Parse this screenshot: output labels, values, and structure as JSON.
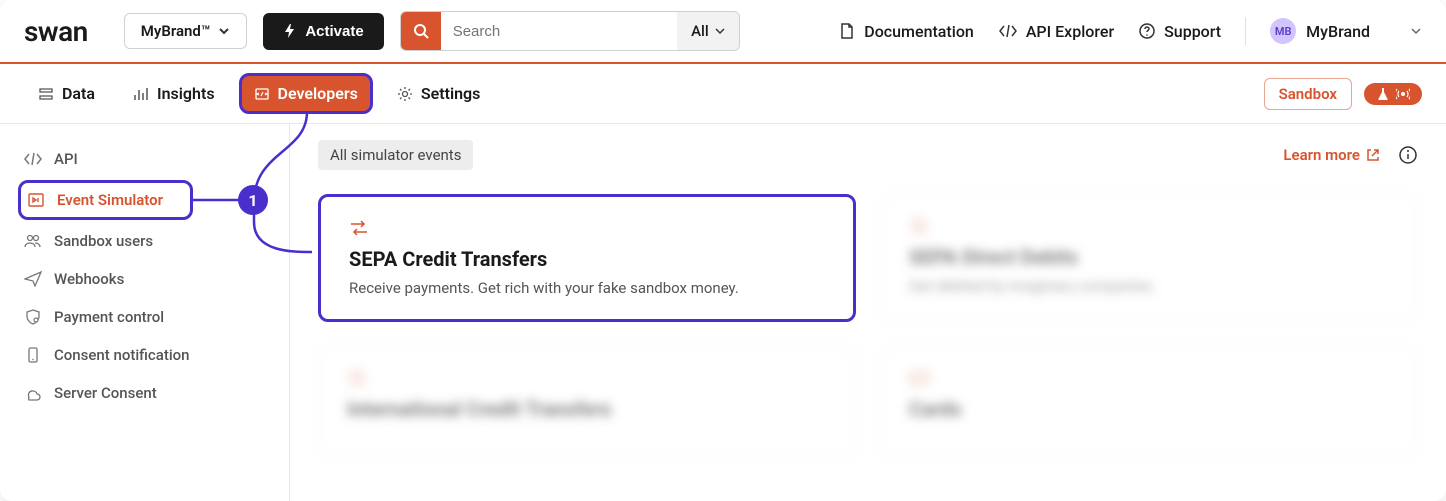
{
  "header": {
    "logo": "swan",
    "brand": "MyBrand™",
    "activate": "Activate",
    "search_placeholder": "Search",
    "search_filter": "All",
    "links": {
      "docs": "Documentation",
      "api": "API Explorer",
      "support": "Support"
    },
    "user": {
      "initials": "MB",
      "name": "MyBrand"
    }
  },
  "nav": {
    "tabs": [
      "Data",
      "Insights",
      "Developers",
      "Settings"
    ],
    "active": 2,
    "sandbox": "Sandbox"
  },
  "sidebar": {
    "items": [
      "API",
      "Event Simulator",
      "Sandbox users",
      "Webhooks",
      "Payment control",
      "Consent notification",
      "Server Consent"
    ],
    "active": 1
  },
  "content": {
    "chip": "All simulator events",
    "learn": "Learn more",
    "cards": [
      {
        "title": "SEPA Credit Transfers",
        "desc": "Receive payments. Get rich with your fake sandbox money."
      },
      {
        "title": "SEPA Direct Debits",
        "desc": "Get debited by imaginary companies."
      },
      {
        "title": "International Credit Transfers",
        "desc": ""
      },
      {
        "title": "Cards",
        "desc": ""
      }
    ]
  },
  "annotation": {
    "step": "1"
  },
  "colors": {
    "accent": "#d8542f",
    "highlight": "#4b2fcc"
  }
}
